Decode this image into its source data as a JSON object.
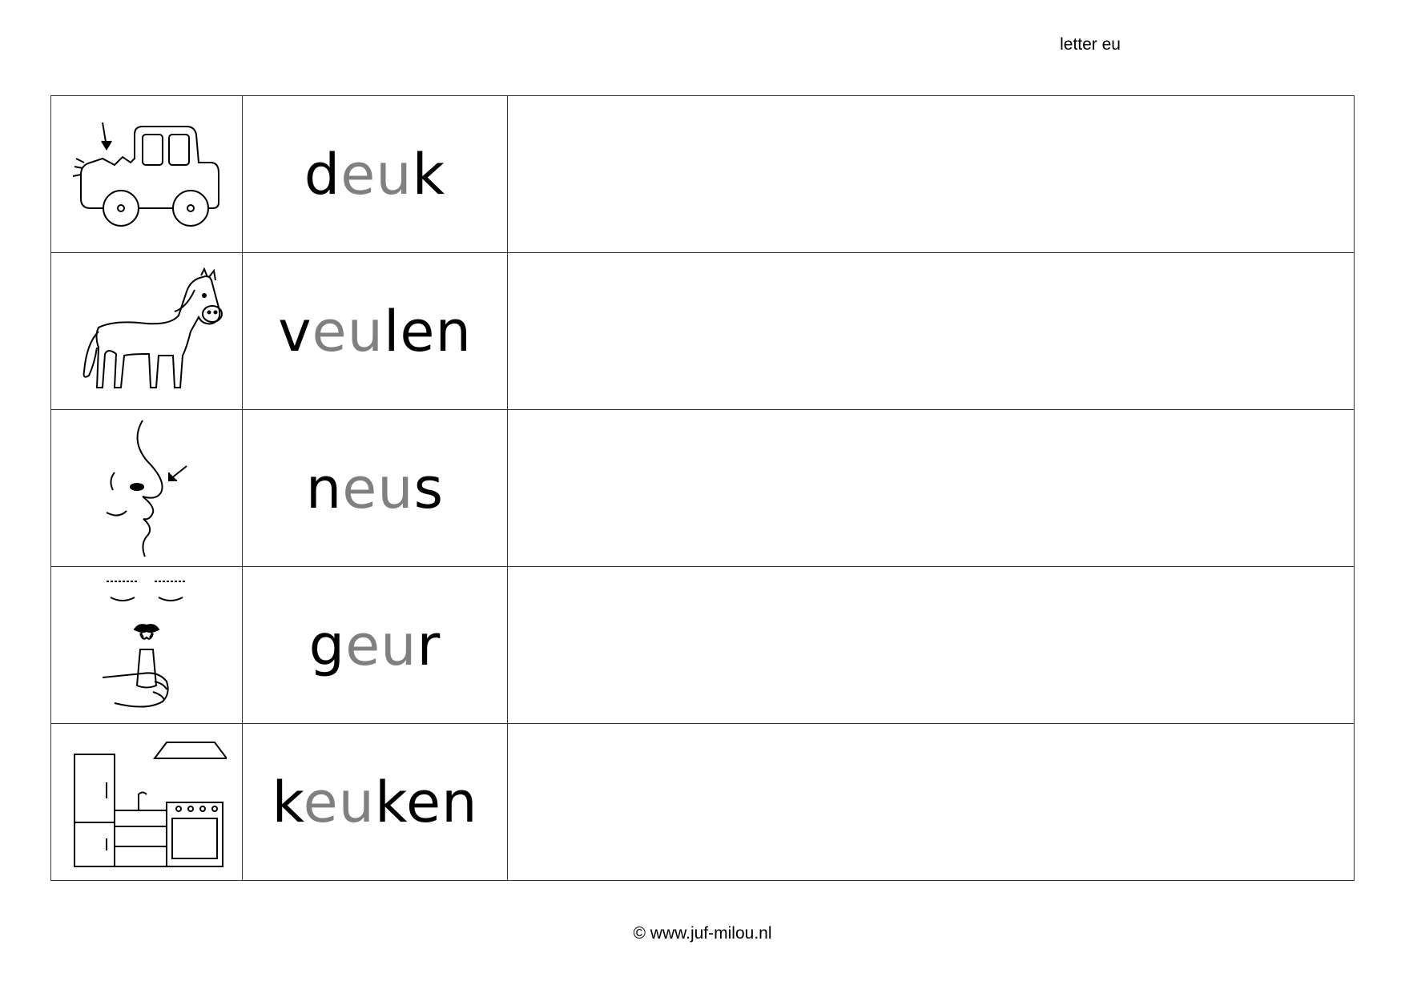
{
  "header": {
    "label": "letter eu"
  },
  "rows": [
    {
      "icon": "car-dent-icon",
      "pre": "d",
      "vowel": "eu",
      "post": "k"
    },
    {
      "icon": "foal-icon",
      "pre": "v",
      "vowel": "eu",
      "post": "len"
    },
    {
      "icon": "nose-icon",
      "pre": "n",
      "vowel": "eu",
      "post": "s"
    },
    {
      "icon": "smell-icon",
      "pre": "g",
      "vowel": "eu",
      "post": "r"
    },
    {
      "icon": "kitchen-icon",
      "pre": "k",
      "vowel": "eu",
      "post": "ken"
    }
  ],
  "colors": {
    "highlight": "#808080",
    "text": "#000000",
    "border": "#333333"
  },
  "footer": {
    "copyright": "© www.juf-milou.nl"
  }
}
